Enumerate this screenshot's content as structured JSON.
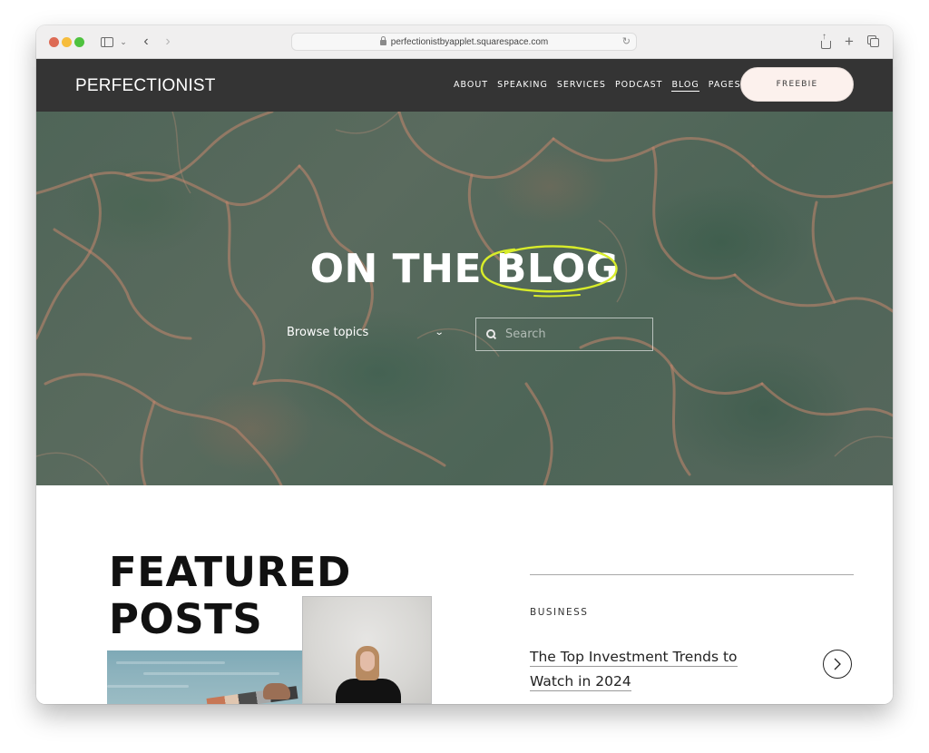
{
  "browser": {
    "url": "perfectionistbyapplet.squarespace.com",
    "icons": [
      "close-dot",
      "minimize-dot",
      "zoom-dot",
      "sidebar-icon",
      "chevron-down-icon",
      "back-arrow-icon",
      "forward-arrow-icon",
      "lock-icon",
      "reload-icon",
      "share-icon",
      "new-tab-icon",
      "tab-overview-icon"
    ]
  },
  "header": {
    "logo": "PERFECTIONIST",
    "nav": [
      {
        "label": "ABOUT",
        "active": false
      },
      {
        "label": "SPEAKING",
        "active": false
      },
      {
        "label": "SERVICES",
        "active": false
      },
      {
        "label": "PODCAST",
        "active": false
      },
      {
        "label": "BLOG",
        "active": true
      },
      {
        "label": "PAGES",
        "active": false
      }
    ],
    "cta": "FREEBIE"
  },
  "hero": {
    "title_prefix": "ON THE ",
    "title_highlight": "BLOG",
    "highlight_color": "#d8ec2a",
    "browse_label": "Browse topics",
    "search_placeholder": "Search"
  },
  "featured": {
    "title_line1": "FEATURED",
    "title_line2": "POSTS",
    "post": {
      "category": "BUSINESS",
      "title_line1": "The Top Investment Trends to",
      "title_line2": "Watch in 2024"
    }
  },
  "colors": {
    "header_bg": "#343434",
    "cta_bg": "#fcf1ed",
    "hero_tint": "#4f6558"
  }
}
